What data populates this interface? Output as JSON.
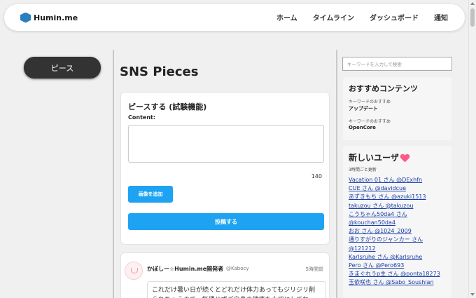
{
  "header": {
    "logo_text": "Humin.me",
    "nav": [
      "ホーム",
      "タイムライン",
      "ダッシュボード",
      "通知"
    ]
  },
  "sidebar_left": {
    "piece_button": "ピース"
  },
  "main": {
    "page_title": "SNS Pieces",
    "compose": {
      "title": "ピースする (試験機能)",
      "content_label": "Content:",
      "content_value": "",
      "counter": "140",
      "add_image": "画像を追加",
      "submit": "投稿する"
    },
    "post": {
      "author": "かぼしー☆Humin.me開発者",
      "handle": "@Kabocy",
      "time": "5時間前",
      "body": "これだけ暑い日が続くとどれだけ体力あってもジリジリ削られちゃうので、無理せずご自身の健康を大切にしてね"
    }
  },
  "sidebar_right": {
    "search_placeholder": "キーワードを入力して検索",
    "recommended": {
      "title": "おすすめコンテンツ",
      "items": [
        {
          "label": "キーワードのおすすめ",
          "title": "アップデート"
        },
        {
          "label": "キーワードのおすすめ",
          "title": "OpenCore"
        }
      ]
    },
    "new_users": {
      "title": "新しいユーザ",
      "subtitle": "3時間ごと更新",
      "users": [
        "Vacation 01 さん @DExhfn",
        "CUE さん @davidcue",
        "あずきもち さん @azuki1513",
        "takuzou さん @takuzou",
        "こうちゃん50da4 さん",
        "@kouchan50da4",
        "おお さん @1024_2009",
        "通りすがりのジャンカー さん",
        "@121212",
        "Karlsruhe さん @Karlsruhe",
        "Pero さん @Pero693",
        "きまぐれうp主 さん @ponta18273",
        "玉依咲也 さん @Sabo_Soushian"
      ]
    }
  }
}
